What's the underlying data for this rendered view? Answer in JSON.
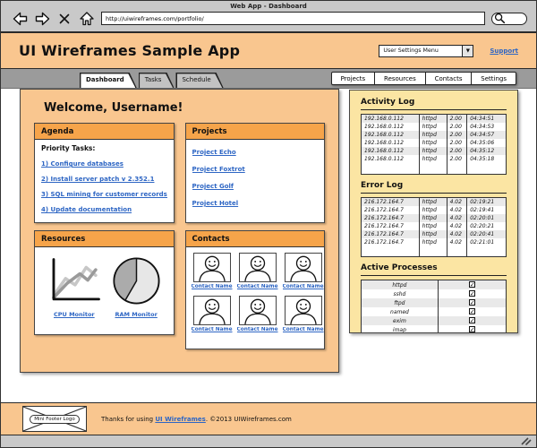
{
  "browser": {
    "window_title": "Web App - Dashboard",
    "url": "http://uiwireframes.com/portfolio/"
  },
  "header": {
    "app_title": "UI Wireframes Sample App",
    "user_menu_label": "User Settings Menu",
    "support_label": "Support"
  },
  "tabs": [
    {
      "label": "Dashboard",
      "active": true
    },
    {
      "label": "Tasks",
      "active": false
    },
    {
      "label": "Schedule",
      "active": false
    }
  ],
  "nav_buttons": [
    "Projects",
    "Resources",
    "Contacts",
    "Settings"
  ],
  "main": {
    "welcome": "Welcome, Username!",
    "agenda": {
      "title": "Agenda",
      "subtitle": "Priority Tasks:",
      "items": [
        "1) Configure databases",
        "2) Install server patch v 2.352.1",
        "3) SQL mining for customer records...",
        "4) Update documentation"
      ]
    },
    "projects": {
      "title": "Projects",
      "links": [
        "Project Echo",
        "Project Foxtrot",
        "Project Golf",
        "Project Hotel"
      ]
    },
    "resources": {
      "title": "Resources",
      "charts": [
        {
          "type": "line",
          "label": "CPU Monitor"
        },
        {
          "type": "pie",
          "label": "RAM Monitor"
        }
      ]
    },
    "contacts": {
      "title": "Contacts",
      "cards": [
        "Contact Name",
        "Contact Name",
        "Contact Name",
        "Contact Name",
        "Contact Name",
        "Contact Name"
      ]
    }
  },
  "sidebar": {
    "activity_log": {
      "title": "Activity Log",
      "rows": [
        [
          "192.168.0.112",
          "httpd",
          "2.00",
          "04:34:51"
        ],
        [
          "192.168.0.112",
          "httpd",
          "2.00",
          "04:34:53"
        ],
        [
          "192.168.0.112",
          "httpd",
          "2.00",
          "04:34:57"
        ],
        [
          "192.168.0.112",
          "httpd",
          "2.00",
          "04:35:06"
        ],
        [
          "192.168.0.112",
          "httpd",
          "2.00",
          "04:35:12"
        ],
        [
          "192.168.0.112",
          "httpd",
          "2.00",
          "04:35:18"
        ]
      ]
    },
    "error_log": {
      "title": "Error Log",
      "rows": [
        [
          "216.172.164.7",
          "httpd",
          "4.02",
          "02:19:21"
        ],
        [
          "216.172.164.7",
          "httpd",
          "4.02",
          "02:19:41"
        ],
        [
          "216.172.164.7",
          "httpd",
          "4.02",
          "02:20:01"
        ],
        [
          "216.172.164.7",
          "httpd",
          "4.02",
          "02:20:21"
        ],
        [
          "216.172.164.7",
          "httpd",
          "4.02",
          "02:20:41"
        ],
        [
          "216.172.164.7",
          "httpd",
          "4.02",
          "02:21:01"
        ]
      ]
    },
    "active_processes": {
      "title": "Active Processes",
      "rows": [
        {
          "name": "httpd",
          "checked": true
        },
        {
          "name": "sshd",
          "checked": true
        },
        {
          "name": "ftpd",
          "checked": true
        },
        {
          "name": "named",
          "checked": true
        },
        {
          "name": "exim",
          "checked": true
        },
        {
          "name": "imap",
          "checked": true
        }
      ]
    }
  },
  "footer": {
    "logo_label": "Mini Footer Logo",
    "text_prefix": "Thanks for using ",
    "link_label": "UI Wireframes",
    "text_suffix": ". ©2013 UIWireframes.com"
  },
  "colors": {
    "peach": "#f9c68f",
    "panel_header_orange": "#f6a44a",
    "sidebar_yellow": "#fbe5a3",
    "link_blue": "#2e66c4",
    "chrome_gray": "#c9c9c9",
    "band_gray": "#9b9b9b"
  }
}
